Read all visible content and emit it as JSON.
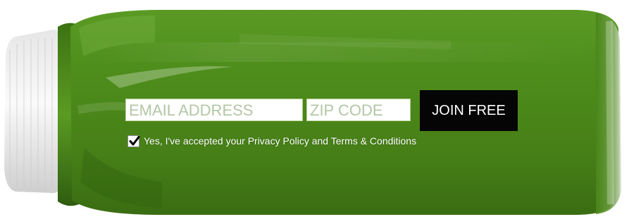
{
  "colors": {
    "juice_green": "#4f8f1c",
    "juice_dark": "#2f5d12",
    "cap_white": "#f2f2f2",
    "button_bg": "#050505",
    "button_text": "#ffffff",
    "consent_text": "#ffffff"
  },
  "image": {
    "subject": "green-juice-bottle"
  },
  "form": {
    "email_placeholder": "EMAIL ADDRESS",
    "email_value": "",
    "zip_placeholder": "ZIP CODE",
    "zip_value": "",
    "join_label": "JOIN FREE",
    "consent_checked": true,
    "consent_label": "Yes, I've accepted your Privacy Policy and Terms & Conditions"
  },
  "icons": {
    "checkbox_mark": "checkmark-icon"
  }
}
